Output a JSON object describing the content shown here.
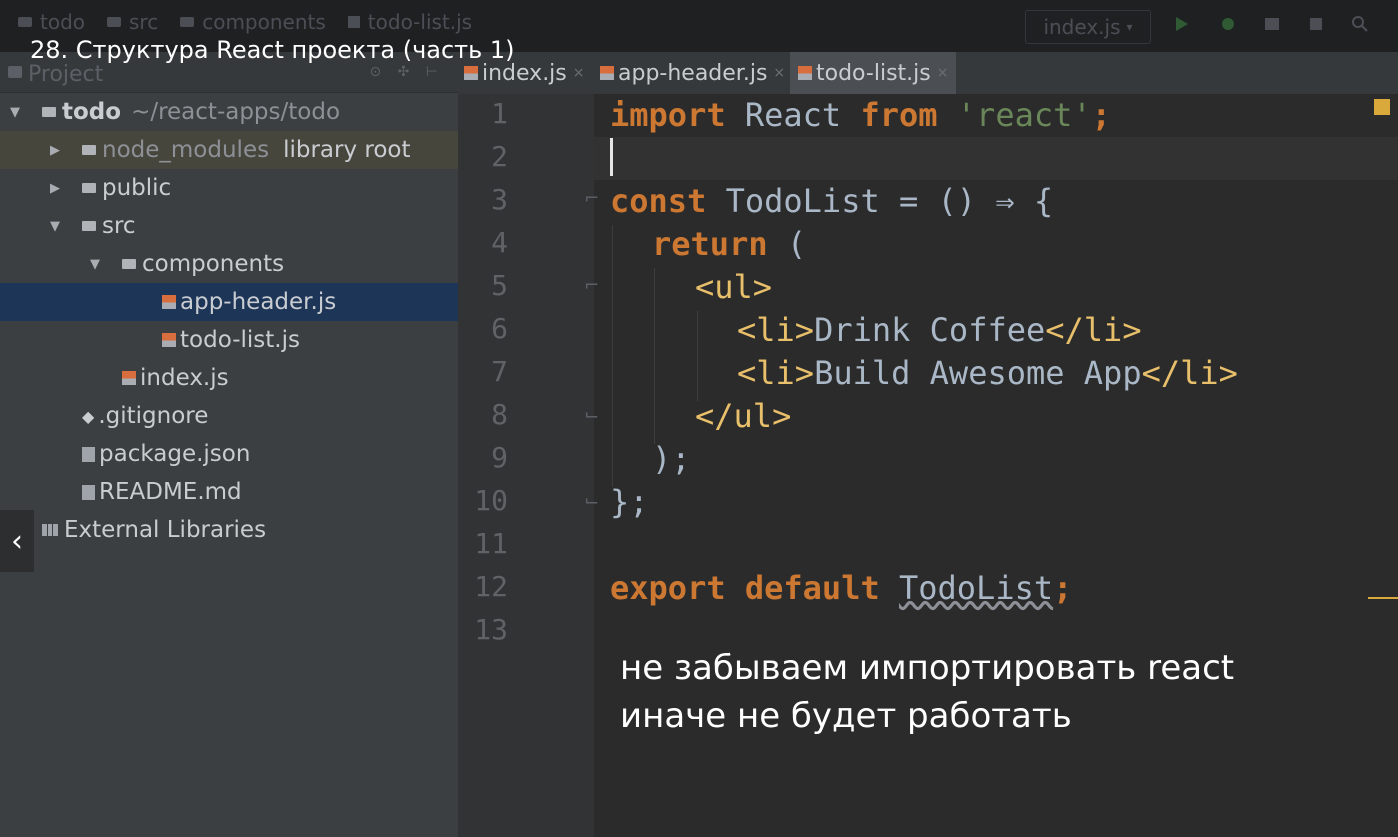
{
  "video_title": "28. Структура React проекта (часть 1)",
  "navbar": {
    "breadcrumbs": [
      "todo",
      "src",
      "components",
      "todo-list.js"
    ],
    "run_config": "index.js"
  },
  "project_panel": {
    "title": "Project",
    "tree": [
      {
        "label": "todo",
        "extra": "~/react-apps/todo"
      },
      {
        "label": "node_modules",
        "extra": "library root"
      },
      {
        "label": "public"
      },
      {
        "label": "src"
      },
      {
        "label": "components"
      },
      {
        "label": "app-header.js"
      },
      {
        "label": "todo-list.js"
      },
      {
        "label": "index.js"
      },
      {
        "label": ".gitignore"
      },
      {
        "label": "package.json"
      },
      {
        "label": "README.md"
      },
      {
        "label": "External Libraries"
      }
    ]
  },
  "editor": {
    "tabs": [
      "index.js",
      "app-header.js",
      "todo-list.js"
    ],
    "active_tab": "todo-list.js",
    "line_numbers": [
      "1",
      "2",
      "3",
      "4",
      "5",
      "6",
      "7",
      "8",
      "9",
      "10",
      "11",
      "12",
      "13"
    ],
    "code": {
      "l1": {
        "kw1": "import",
        "id": " React ",
        "kw2": "from",
        "str": " 'react'",
        "punct": ";"
      },
      "l3": {
        "kw": "const",
        "rest": " TodoList = () ⇒ {"
      },
      "l4": {
        "kw": "return",
        "rest": " ("
      },
      "l5": {
        "tag": "<ul>"
      },
      "l6": {
        "open": "<li>",
        "text": "Drink Coffee",
        "close": "</li>"
      },
      "l7": {
        "open": "<li>",
        "text": "Build Awesome App",
        "close": "</li>"
      },
      "l8": {
        "tag": "</ul>"
      },
      "l9": {
        "text": ");"
      },
      "l10": {
        "text": "};"
      },
      "l12": {
        "kw1": "export",
        "kw2": "default",
        "id": "TodoList",
        "punct": ";"
      }
    }
  },
  "subtitles": [
    "не забываем импортировать react",
    "иначе не будет работать"
  ],
  "colors": {
    "keyword": "#cc7832",
    "string": "#6a8759",
    "tag": "#e8bf6a",
    "selection": "#1d3557"
  }
}
